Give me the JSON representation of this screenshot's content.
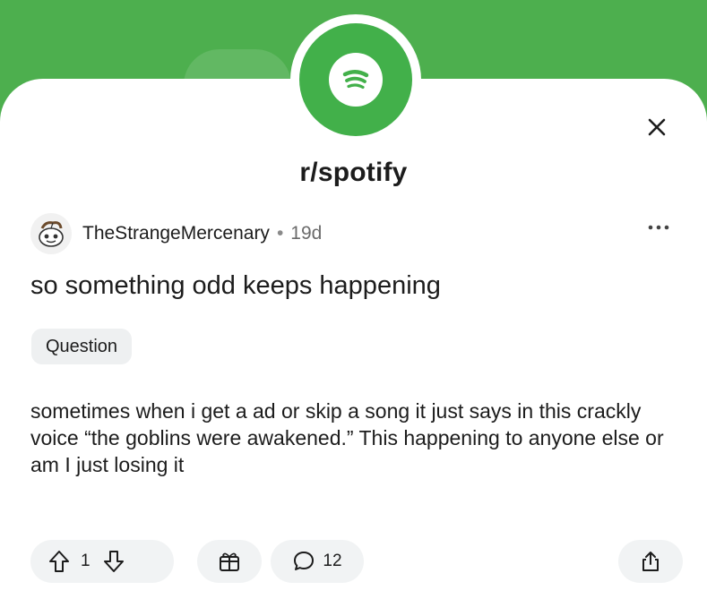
{
  "community": {
    "name": "r/spotify",
    "icon": "spotify-logo-icon"
  },
  "post": {
    "author": "TheStrangeMercenary",
    "separator": "•",
    "age": "19d",
    "title": "so something odd keeps happening",
    "flair": "Question",
    "body": "sometimes when i get a ad or skip a song it just says in this crackly voice “the goblins were awakened.” This happening to anyone else or am I just losing it",
    "upvotes": "1",
    "comments": "12"
  },
  "icons": {
    "close": "close-icon",
    "more": "more-options-icon",
    "upvote": "upvote-icon",
    "downvote": "downvote-icon",
    "award": "award-icon",
    "comment": "comment-icon",
    "share": "share-icon"
  },
  "colors": {
    "brand_green": "#4daf4e",
    "text": "#1c1c1c",
    "pill_bg": "#f1f3f4"
  }
}
